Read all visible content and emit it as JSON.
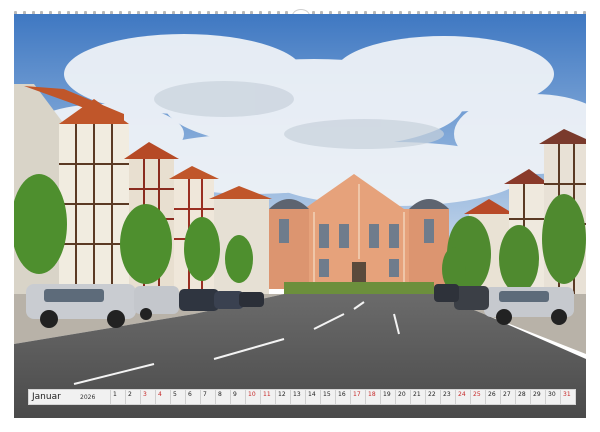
{
  "calendar": {
    "month": "Januar",
    "year": "2026",
    "days": [
      {
        "d": "1",
        "we": false
      },
      {
        "d": "2",
        "we": false
      },
      {
        "d": "3",
        "we": true
      },
      {
        "d": "4",
        "we": true
      },
      {
        "d": "5",
        "we": false
      },
      {
        "d": "6",
        "we": false
      },
      {
        "d": "7",
        "we": false
      },
      {
        "d": "8",
        "we": false
      },
      {
        "d": "9",
        "we": false
      },
      {
        "d": "10",
        "we": true
      },
      {
        "d": "11",
        "we": true
      },
      {
        "d": "12",
        "we": false
      },
      {
        "d": "13",
        "we": false
      },
      {
        "d": "14",
        "we": false
      },
      {
        "d": "15",
        "we": false
      },
      {
        "d": "16",
        "we": false
      },
      {
        "d": "17",
        "we": true
      },
      {
        "d": "18",
        "we": true
      },
      {
        "d": "19",
        "we": false
      },
      {
        "d": "20",
        "we": false
      },
      {
        "d": "21",
        "we": false
      },
      {
        "d": "22",
        "we": false
      },
      {
        "d": "23",
        "we": false
      },
      {
        "d": "24",
        "we": true
      },
      {
        "d": "25",
        "we": true
      },
      {
        "d": "26",
        "we": false
      },
      {
        "d": "27",
        "we": false
      },
      {
        "d": "28",
        "we": false
      },
      {
        "d": "29",
        "we": false
      },
      {
        "d": "30",
        "we": false
      },
      {
        "d": "31",
        "we": true
      }
    ]
  },
  "colors": {
    "weekend": "#c62828",
    "weekday": "#222222",
    "sky": "#4f86c9",
    "church": "#e7a27a"
  }
}
